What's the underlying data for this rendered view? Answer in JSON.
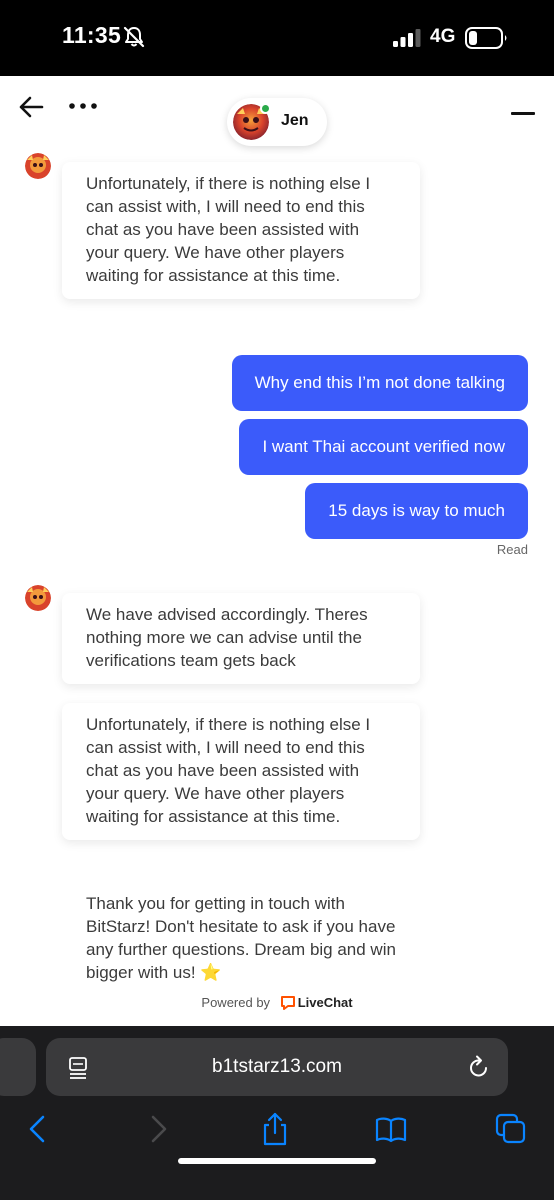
{
  "status_bar": {
    "time": "11:35",
    "network": "4G"
  },
  "header": {
    "agent_name": "Jen"
  },
  "messages": [
    {
      "from": "agent",
      "text": "Unfortunately, if there is nothing else I can assist with, I will need to end this chat as you have been assisted with your query. We have other players waiting for assistance at this time."
    },
    {
      "from": "user",
      "text": "Why end this I’m not done talking"
    },
    {
      "from": "user",
      "text": "I want Thai account verified now"
    },
    {
      "from": "user",
      "text": "15 days is way to much"
    },
    {
      "from": "agent",
      "text": "We have advised accordingly. Theres nothing more we can advise until the verifications team gets back"
    },
    {
      "from": "agent",
      "text": "Unfortunately, if there is nothing else I can assist with, I will need to end this chat as you have been assisted with your query. We have other players waiting for assistance at this time."
    },
    {
      "from": "agent",
      "text": "Thank you for getting in touch with BitStarz! Don't hesitate to ask if you have any further questions. Dream big and win bigger with us! ⭐"
    }
  ],
  "read_status": "Read",
  "powered": {
    "prefix": "Powered by",
    "brand": "LiveChat"
  },
  "browser": {
    "url": "b1tstarz13.com"
  },
  "colors": {
    "user_bubble": "#3b5bfa",
    "online_dot": "#2aaa4a",
    "ios_blue": "#0a84ff",
    "livechat_orange": "#ff5100"
  }
}
